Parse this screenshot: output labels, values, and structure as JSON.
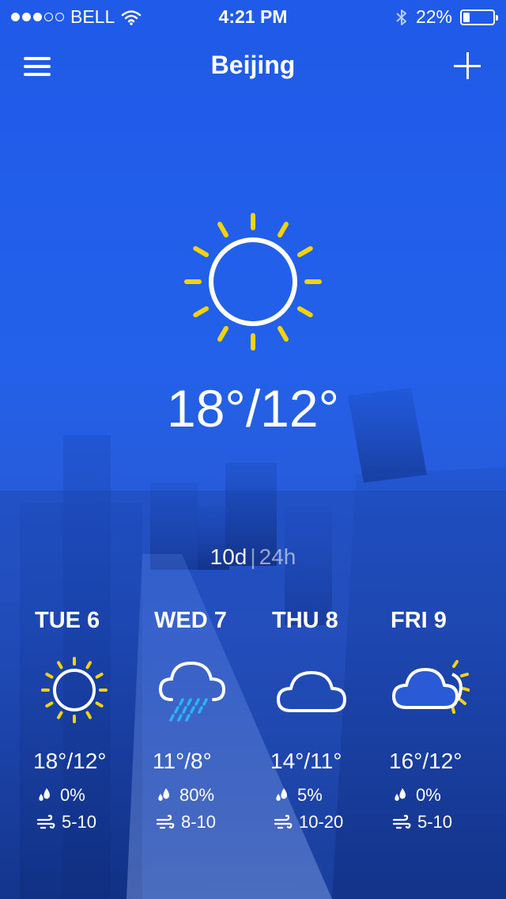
{
  "status_bar": {
    "carrier": "BELL",
    "time": "4:21 PM",
    "battery_percent": "22%",
    "battery_level": 0.22,
    "signal_bars_filled": 3,
    "signal_bars_total": 5
  },
  "header": {
    "city": "Beijing"
  },
  "current": {
    "condition_icon": "sun-icon",
    "temperature": "18°/12°"
  },
  "range_toggle": {
    "active": "10d",
    "separator": "|",
    "inactive": "24h"
  },
  "forecast": [
    {
      "day": "TUE 6",
      "icon": "sun-icon",
      "temps": "18°/12°",
      "precip": "0%",
      "wind": "5-10"
    },
    {
      "day": "WED 7",
      "icon": "cloud-rain-icon",
      "temps": "11°/8°",
      "precip": "80%",
      "wind": "8-10"
    },
    {
      "day": "THU 8",
      "icon": "cloud-icon",
      "temps": "14°/11°",
      "precip": "5%",
      "wind": "10-20"
    },
    {
      "day": "FRI 9",
      "icon": "partly-cloudy-icon",
      "temps": "16°/12°",
      "precip": "0%",
      "wind": "5-10"
    }
  ],
  "colors": {
    "sun": "#f5d20f",
    "rain": "#29b6f6",
    "background": "#2361ea"
  }
}
